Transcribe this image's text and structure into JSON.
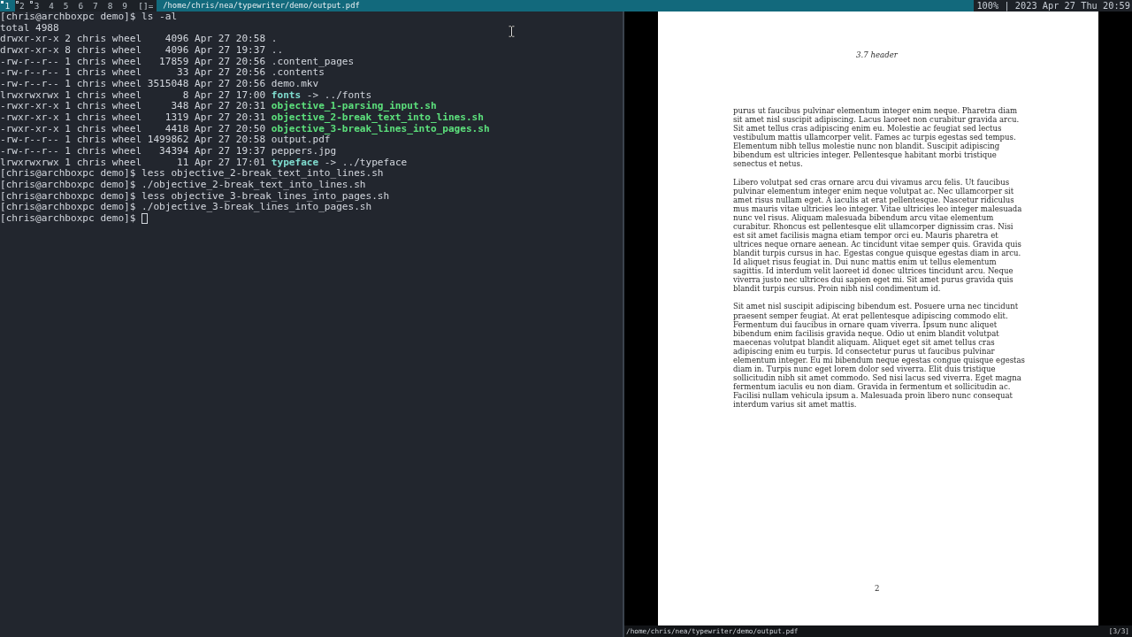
{
  "top_bar": {
    "tags": [
      {
        "label": "1",
        "selected": true,
        "occupied": true
      },
      {
        "label": "2",
        "selected": false,
        "occupied": true
      },
      {
        "label": "3",
        "selected": false,
        "occupied": true
      },
      {
        "label": "4",
        "selected": false,
        "occupied": false
      },
      {
        "label": "5",
        "selected": false,
        "occupied": false
      },
      {
        "label": "6",
        "selected": false,
        "occupied": false
      },
      {
        "label": "7",
        "selected": false,
        "occupied": false
      },
      {
        "label": "8",
        "selected": false,
        "occupied": false
      },
      {
        "label": "9",
        "selected": false,
        "occupied": false
      }
    ],
    "layout_symbol": "[]=",
    "window_title": "/home/chris/nea/typewriter/demo/output.pdf",
    "status": "100% | 2023 Apr 27 Thu 20:59"
  },
  "terminal": {
    "lines": [
      {
        "kind": "prompt",
        "prompt": "[chris@archboxpc demo]$",
        "command": "ls -al",
        "cursor": false
      },
      {
        "kind": "output",
        "text": "total 4988"
      },
      {
        "kind": "dir",
        "info": "drwxr-xr-x 2 chris wheel    4096 Apr 27 20:58",
        "name": "."
      },
      {
        "kind": "dir",
        "info": "drwxr-xr-x 8 chris wheel    4096 Apr 27 19:37",
        "name": ".."
      },
      {
        "kind": "file",
        "info": "-rw-r--r-- 1 chris wheel   17859 Apr 27 20:56",
        "name": ".content_pages"
      },
      {
        "kind": "file",
        "info": "-rw-r--r-- 1 chris wheel      33 Apr 27 20:56",
        "name": ".contents"
      },
      {
        "kind": "file",
        "info": "-rw-r--r-- 1 chris wheel 3515048 Apr 27 20:56",
        "name": "demo.mkv"
      },
      {
        "kind": "link",
        "info": "lrwxrwxrwx 1 chris wheel       8 Apr 27 17:00",
        "name": "fonts",
        "target": "-> ../fonts"
      },
      {
        "kind": "exec",
        "info": "-rwxr-xr-x 1 chris wheel     348 Apr 27 20:31",
        "name": "objective_1-parsing_input.sh"
      },
      {
        "kind": "exec",
        "info": "-rwxr-xr-x 1 chris wheel    1319 Apr 27 20:31",
        "name": "objective_2-break_text_into_lines.sh"
      },
      {
        "kind": "exec",
        "info": "-rwxr-xr-x 1 chris wheel    4418 Apr 27 20:50",
        "name": "objective_3-break_lines_into_pages.sh"
      },
      {
        "kind": "file",
        "info": "-rw-r--r-- 1 chris wheel 1499862 Apr 27 20:58",
        "name": "output.pdf"
      },
      {
        "kind": "file",
        "info": "-rw-r--r-- 1 chris wheel   34394 Apr 27 19:37",
        "name": "peppers.jpg"
      },
      {
        "kind": "link",
        "info": "lrwxrwxrwx 1 chris wheel      11 Apr 27 17:01",
        "name": "typeface",
        "target": "-> ../typeface"
      },
      {
        "kind": "prompt",
        "prompt": "[chris@archboxpc demo]$",
        "command": "less objective_2-break_text_into_lines.sh",
        "cursor": false
      },
      {
        "kind": "prompt",
        "prompt": "[chris@archboxpc demo]$",
        "command": "./objective_2-break_text_into_lines.sh",
        "cursor": false
      },
      {
        "kind": "prompt",
        "prompt": "[chris@archboxpc demo]$",
        "command": "less objective_3-break_lines_into_pages.sh",
        "cursor": false
      },
      {
        "kind": "prompt",
        "prompt": "[chris@archboxpc demo]$",
        "command": "./objective_3-break_lines_into_pages.sh",
        "cursor": false
      },
      {
        "kind": "prompt",
        "prompt": "[chris@archboxpc demo]$",
        "cursor": true
      }
    ]
  },
  "pdf_viewer": {
    "page": {
      "header": "3.7 header",
      "paragraphs": [
        "purus ut faucibus pulvinar elementum integer enim neque. Pharetra diam sit amet nisl suscipit adipiscing. Lacus laoreet non curabitur gravida arcu. Sit amet tellus cras adipiscing enim eu. Molestie ac feugiat sed lectus vestibulum mattis ullamcorper velit. Fames ac turpis egestas sed tempus. Elementum nibh tellus molestie nunc non blandit. Suscipit adipiscing bibendum est ultricies integer. Pellentesque habitant morbi tristique senectus et netus.",
        "Libero volutpat sed cras ornare arcu dui vivamus arcu felis. Ut faucibus pulvinar elementum integer enim neque volutpat ac. Nec ullamcorper sit amet risus nullam eget. A iaculis at erat pellentesque. Nascetur ridiculus mus mauris vitae ultricies leo integer. Vitae ultricies leo integer malesuada nunc vel risus. Aliquam malesuada bibendum arcu vitae elementum curabitur. Rhoncus est pellentesque elit ullamcorper dignissim cras. Nisi est sit amet facilisis magna etiam tempor orci eu. Mauris pharetra et ultrices neque ornare aenean. Ac tincidunt vitae semper quis. Gravida quis blandit turpis cursus in hac. Egestas congue quisque egestas diam in arcu. Id aliquet risus feugiat in. Dui nunc mattis enim ut tellus elementum sagittis. Id interdum velit laoreet id donec ultrices tincidunt arcu. Neque viverra justo nec ultrices dui sapien eget mi. Sit amet purus gravida quis blandit turpis cursus. Proin nibh nisl condimentum id.",
        "Sit amet nisl suscipit adipiscing bibendum est. Posuere urna nec tincidunt praesent semper feugiat. At erat pellentesque adipiscing commodo elit. Fermentum dui faucibus in ornare quam viverra. Ipsum nunc aliquet bibendum enim facilisis gravida neque. Odio ut enim blandit volutpat maecenas volutpat blandit aliquam. Aliquet eget sit amet tellus cras adipiscing enim eu turpis. Id consectetur purus ut faucibus pulvinar elementum integer. Eu mi bibendum neque egestas congue quisque egestas diam in. Turpis nunc eget lorem dolor sed viverra. Elit duis tristique sollicitudin nibh sit amet commodo. Sed nisi lacus sed viverra. Eget magna fermentum iaculis eu non diam. Gravida in fermentum et sollicitudin ac. Facilisi nullam vehicula ipsum a. Malesuada proin libero nunc consequat interdum varius sit amet mattis."
      ],
      "page_number": "2"
    },
    "status_bar": {
      "path": "/home/chris/nea/typewriter/demo/output.pdf",
      "page_count": "[3/3]"
    }
  }
}
